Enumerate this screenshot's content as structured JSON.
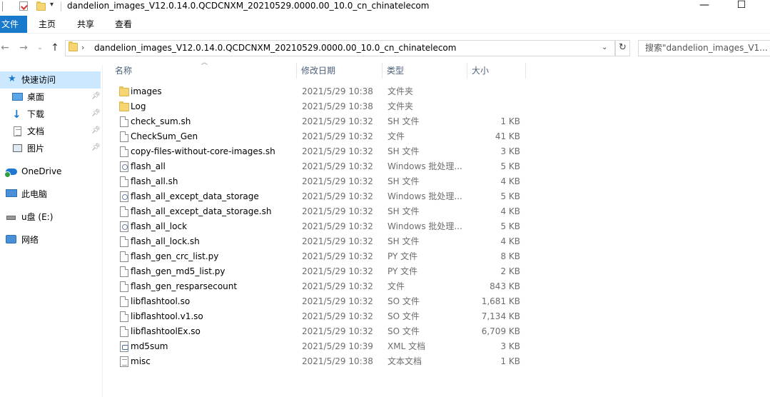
{
  "window": {
    "title": "dandelion_images_V12.0.14.0.QCDCNXM_20210529.0000.00_10.0_cn_chinatelecom",
    "minimize_glyph": "—",
    "maximize_glyph": "☐"
  },
  "ribbon": {
    "tabs": [
      {
        "label": "文件"
      },
      {
        "label": "主页"
      },
      {
        "label": "共享"
      },
      {
        "label": "查看"
      }
    ]
  },
  "address": {
    "path": "dandelion_images_V12.0.14.0.QCDCNXM_20210529.0000.00_10.0_cn_chinatelecom",
    "search_placeholder": "搜索\"dandelion_images_V1..."
  },
  "sidebar": {
    "items": [
      {
        "label": "快速访问",
        "icon": "star-icon"
      },
      {
        "label": "桌面",
        "icon": "desktop-icon",
        "pinned": true
      },
      {
        "label": "下载",
        "icon": "download-icon",
        "pinned": true
      },
      {
        "label": "文档",
        "icon": "document-icon",
        "pinned": true
      },
      {
        "label": "图片",
        "icon": "picture-icon",
        "pinned": true
      },
      {
        "label": "OneDrive",
        "icon": "onedrive-icon"
      },
      {
        "label": "此电脑",
        "icon": "computer-icon"
      },
      {
        "label": "u盘 (E:)",
        "icon": "usb-drive-icon"
      },
      {
        "label": "网络",
        "icon": "network-icon"
      }
    ]
  },
  "columns": {
    "name": "名称",
    "date": "修改日期",
    "type": "类型",
    "size": "大小"
  },
  "files": [
    {
      "name": "images",
      "date": "2021/5/29 10:38",
      "type": "文件夹",
      "size": "",
      "icon": "folder"
    },
    {
      "name": "Log",
      "date": "2021/5/29 10:38",
      "type": "文件夹",
      "size": "",
      "icon": "folder"
    },
    {
      "name": "check_sum.sh",
      "date": "2021/5/29 10:32",
      "type": "SH 文件",
      "size": "1 KB",
      "icon": "file"
    },
    {
      "name": "CheckSum_Gen",
      "date": "2021/5/29 10:32",
      "type": "文件",
      "size": "41 KB",
      "icon": "file"
    },
    {
      "name": "copy-files-without-core-images.sh",
      "date": "2021/5/29 10:32",
      "type": "SH 文件",
      "size": "3 KB",
      "icon": "file"
    },
    {
      "name": "flash_all",
      "date": "2021/5/29 10:32",
      "type": "Windows 批处理...",
      "size": "5 KB",
      "icon": "bat"
    },
    {
      "name": "flash_all.sh",
      "date": "2021/5/29 10:32",
      "type": "SH 文件",
      "size": "4 KB",
      "icon": "file"
    },
    {
      "name": "flash_all_except_data_storage",
      "date": "2021/5/29 10:32",
      "type": "Windows 批处理...",
      "size": "5 KB",
      "icon": "bat"
    },
    {
      "name": "flash_all_except_data_storage.sh",
      "date": "2021/5/29 10:32",
      "type": "SH 文件",
      "size": "4 KB",
      "icon": "file"
    },
    {
      "name": "flash_all_lock",
      "date": "2021/5/29 10:32",
      "type": "Windows 批处理...",
      "size": "5 KB",
      "icon": "bat"
    },
    {
      "name": "flash_all_lock.sh",
      "date": "2021/5/29 10:32",
      "type": "SH 文件",
      "size": "4 KB",
      "icon": "file"
    },
    {
      "name": "flash_gen_crc_list.py",
      "date": "2021/5/29 10:32",
      "type": "PY 文件",
      "size": "8 KB",
      "icon": "file"
    },
    {
      "name": "flash_gen_md5_list.py",
      "date": "2021/5/29 10:32",
      "type": "PY 文件",
      "size": "2 KB",
      "icon": "file"
    },
    {
      "name": "flash_gen_resparsecount",
      "date": "2021/5/29 10:32",
      "type": "文件",
      "size": "843 KB",
      "icon": "file"
    },
    {
      "name": "libflashtool.so",
      "date": "2021/5/29 10:32",
      "type": "SO 文件",
      "size": "1,681 KB",
      "icon": "file"
    },
    {
      "name": "libflashtool.v1.so",
      "date": "2021/5/29 10:32",
      "type": "SO 文件",
      "size": "7,134 KB",
      "icon": "file"
    },
    {
      "name": "libflashtoolEx.so",
      "date": "2021/5/29 10:32",
      "type": "SO 文件",
      "size": "6,709 KB",
      "icon": "file"
    },
    {
      "name": "md5sum",
      "date": "2021/5/29 10:39",
      "type": "XML 文档",
      "size": "3 KB",
      "icon": "xml"
    },
    {
      "name": "misc",
      "date": "2021/5/29 10:38",
      "type": "文本文档",
      "size": "1 KB",
      "icon": "txt"
    }
  ],
  "colors": {
    "accent": "#1979ca",
    "selected": "#cce8ff",
    "folder": "#f6d572"
  }
}
